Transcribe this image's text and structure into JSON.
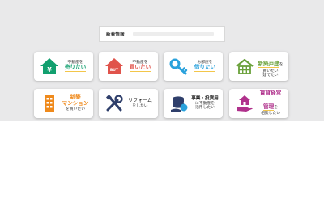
{
  "news": {
    "label": "新着情報"
  },
  "cards": [
    {
      "id": "buy-sell",
      "icon": "house-yen-icon",
      "accent": "#12a06f",
      "line1": "不動産を",
      "line2": "売りたい"
    },
    {
      "id": "buy",
      "icon": "house-buy-icon",
      "accent": "#e0534b",
      "icon_text": "BUY",
      "line1": "不動産を",
      "line2": "買いたい"
    },
    {
      "id": "rent",
      "icon": "key-icon",
      "accent": "#2aa2dc",
      "line1": "お部屋を",
      "line2": "借りたい"
    },
    {
      "id": "new-house",
      "icon": "house-grid-icon",
      "accent": "#6aa13a",
      "line1": "新築戸建",
      "line2": "を",
      "line3": "買いたい",
      "line4": "建てたい"
    },
    {
      "id": "mansion",
      "icon": "building-icon",
      "accent": "#ef8a1c",
      "line1": "新築",
      "line2": "マンション",
      "line3": "を買いたい"
    },
    {
      "id": "reform",
      "icon": "tools-icon",
      "accent": "#2f3f6b",
      "line1": "リフォーム",
      "line2": "をしたい"
    },
    {
      "id": "business",
      "icon": "coins-icon",
      "accent": "#2f3f6b",
      "line1": "事業・投資用",
      "line2": "に不動産を",
      "line3": "活用したい"
    },
    {
      "id": "management",
      "icon": "hand-house-icon",
      "accent": "#b0318c",
      "line1": "賃貸経営",
      "line2": "管理",
      "line3": "を",
      "line4": "相談したい"
    }
  ]
}
